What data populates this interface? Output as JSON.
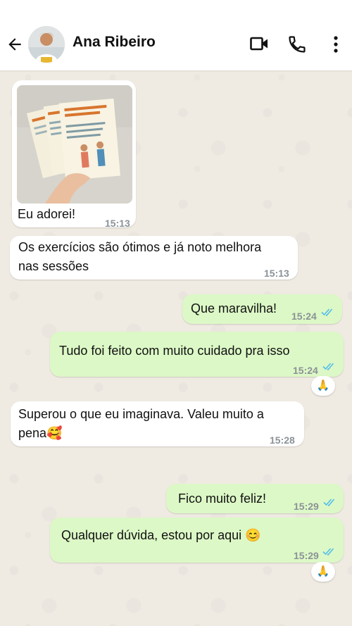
{
  "header": {
    "contact_name": "Ana Ribeiro",
    "icons": [
      "back-arrow-icon",
      "video-call-icon",
      "phone-call-icon",
      "more-options-icon"
    ]
  },
  "messages": [
    {
      "direction": "incoming",
      "type": "image",
      "caption": "Eu adorei!",
      "time": "15:13"
    },
    {
      "direction": "incoming",
      "text_lines": [
        "Os exercícios são ótimos e já noto melhora",
        "nas sessões"
      ],
      "time": "15:13"
    },
    {
      "direction": "outgoing",
      "text": "Que maravilha!",
      "time": "15:24",
      "status": "read"
    },
    {
      "direction": "outgoing",
      "text": "Tudo foi feito com muito cuidado pra isso",
      "time": "15:24",
      "status": "read",
      "reaction": "🙏"
    },
    {
      "direction": "incoming",
      "text_lines": [
        "Superou o que eu imaginava. Valeu muito a",
        "pena🥰"
      ],
      "time": "15:28"
    },
    {
      "direction": "outgoing",
      "text": "Fico muito feliz!",
      "time": "15:29",
      "status": "read"
    },
    {
      "direction": "outgoing",
      "text": "Qualquer dúvida, estou por aqui 😊",
      "time": "15:29",
      "status": "read",
      "reaction": "🙏"
    }
  ],
  "colors": {
    "outgoing_bubble": "#dcf8c6",
    "incoming_bubble": "#ffffff",
    "chat_background": "#efeae2",
    "read_ticks": "#53bdeb"
  }
}
